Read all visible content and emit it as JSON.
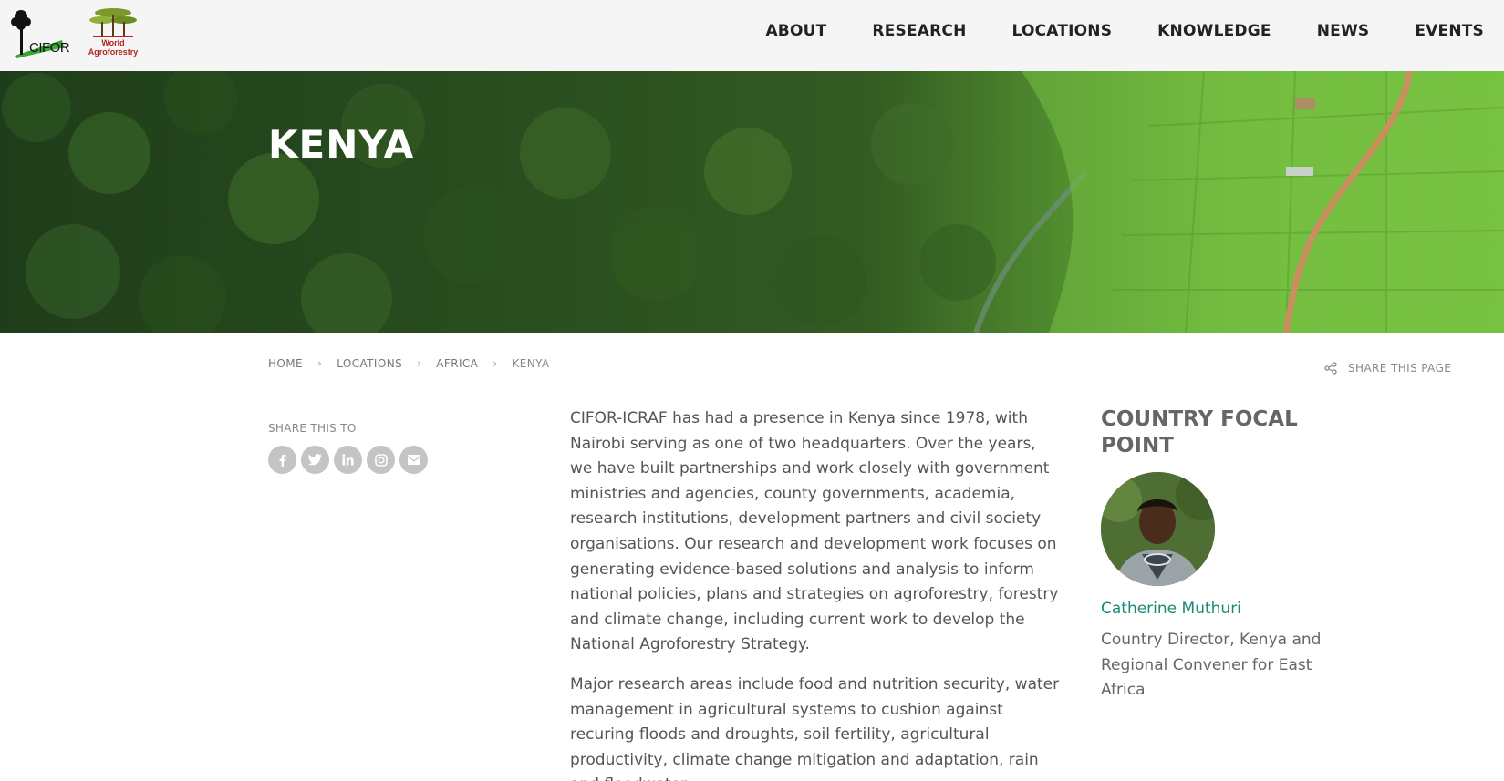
{
  "header": {
    "logos": {
      "cifor_text": "CIFOR",
      "wa_line1": "World",
      "wa_line2": "Agroforestry"
    },
    "nav": [
      {
        "label": "ABOUT"
      },
      {
        "label": "RESEARCH"
      },
      {
        "label": "LOCATIONS"
      },
      {
        "label": "KNOWLEDGE"
      },
      {
        "label": "NEWS"
      },
      {
        "label": "EVENTS"
      }
    ]
  },
  "hero": {
    "title": "KENYA"
  },
  "breadcrumb": {
    "items": [
      "HOME",
      "LOCATIONS",
      "AFRICA",
      "KENYA"
    ],
    "separator": "›"
  },
  "share_page": {
    "label": "SHARE THIS PAGE"
  },
  "share_to": {
    "label": "SHARE THIS TO",
    "icons": [
      "facebook-icon",
      "twitter-icon",
      "linkedin-icon",
      "instagram-icon",
      "email-icon"
    ]
  },
  "content": {
    "paragraph1": "CIFOR-ICRAF has had a presence in Kenya since 1978, with Nairobi serving as one of two headquarters. Over the years, we have built partnerships and work closely with government ministries and agencies, county governments, academia, research institutions, development partners and civil society organisations. Our research and development work focuses on generating evidence-based solutions and analysis to inform national policies, plans and strategies on agroforestry, forestry and climate change, including current work to develop the National Agroforestry Strategy.",
    "paragraph2": "Major research areas include food and nutrition security, water management in agricultural systems to cushion against recuring floods and droughts, soil fertility, agricultural productivity, climate change mitigation and adaptation, rain and floodwater"
  },
  "focal_point": {
    "title": "COUNTRY FOCAL POINT",
    "name": "Catherine Muthuri",
    "role": "Country Director, Kenya and Regional Convener for East Africa"
  },
  "colors": {
    "header_bg": "#f5f5f5",
    "link_teal": "#1b8a74",
    "social_grey": "#c4c4c4",
    "text_grey": "#555555"
  }
}
